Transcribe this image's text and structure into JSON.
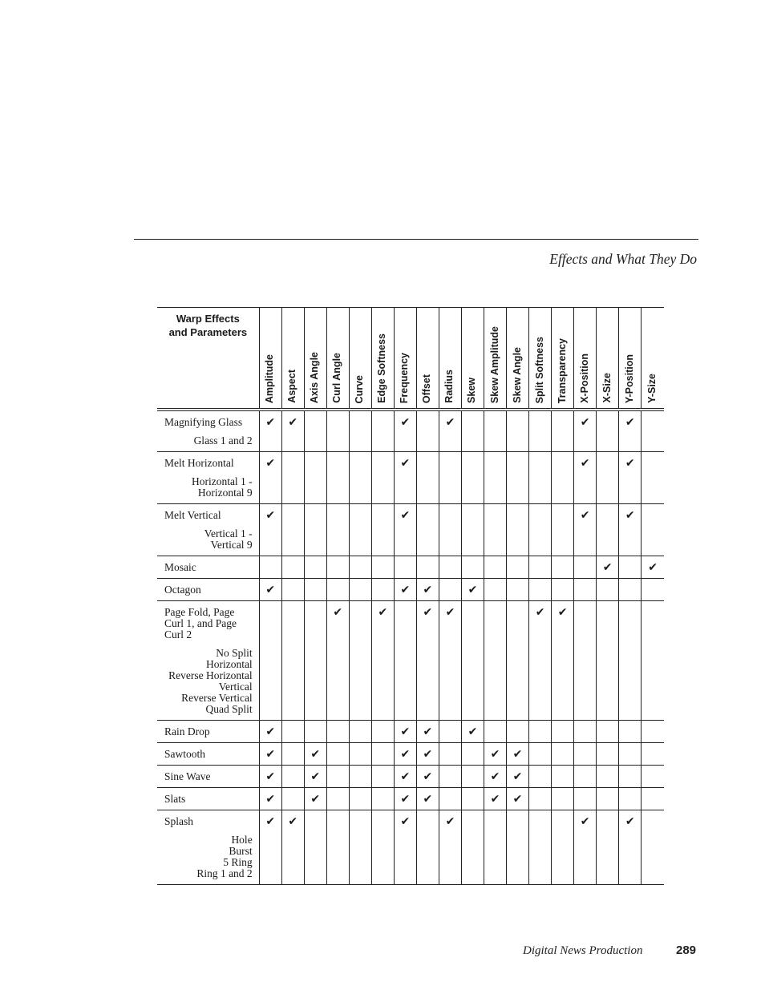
{
  "header": {
    "running_head": "Effects and What They Do"
  },
  "footer": {
    "book_title": "Digital News Production",
    "page_number": "289"
  },
  "table": {
    "title_line1": "Warp Effects",
    "title_line2": "and Parameters",
    "check_glyph": "✔",
    "columns": [
      "Amplitude",
      "Aspect",
      "Axis Angle",
      "Curl Angle",
      "Curve",
      "Edge Softness",
      "Frequency",
      "Offset",
      "Radius",
      "Skew",
      "Skew Amplitude",
      "Skew Angle",
      "Split Softness",
      "Transparency",
      "X-Position",
      "X-Size",
      "Y-Position",
      "Y-Size"
    ],
    "rows": [
      {
        "name": "Magnifying Glass",
        "subs": [
          "Glass 1 and 2"
        ],
        "checks": [
          "Amplitude",
          "Aspect",
          "Frequency",
          "Radius",
          "X-Position",
          "Y-Position"
        ]
      },
      {
        "name": "Melt Horizontal",
        "subs": [
          "Horizontal 1 -",
          "Horizontal 9"
        ],
        "checks": [
          "Amplitude",
          "Frequency",
          "X-Position",
          "Y-Position"
        ]
      },
      {
        "name": "Melt Vertical",
        "subs": [
          "Vertical 1 -",
          "Vertical 9"
        ],
        "checks": [
          "Amplitude",
          "Frequency",
          "X-Position",
          "Y-Position"
        ]
      },
      {
        "name": "Mosaic",
        "subs": [],
        "checks": [
          "X-Size",
          "Y-Size"
        ]
      },
      {
        "name": "Octagon",
        "subs": [],
        "checks": [
          "Amplitude",
          "Frequency",
          "Offset",
          "Skew"
        ]
      },
      {
        "name": "Page Fold, Page Curl 1, and Page Curl 2",
        "name_lines": [
          "Page Fold, Page",
          "Curl 1, and Page",
          "Curl 2"
        ],
        "subs": [
          "No Split",
          "Horizontal",
          "Reverse Horizontal",
          "Vertical",
          "Reverse Vertical",
          "Quad Split"
        ],
        "checks": [
          "Curl Angle",
          "Edge Softness",
          "Offset",
          "Radius",
          "Split Softness",
          "Transparency"
        ]
      },
      {
        "name": "Rain Drop",
        "subs": [],
        "checks": [
          "Amplitude",
          "Frequency",
          "Offset",
          "Skew"
        ]
      },
      {
        "name": "Sawtooth",
        "subs": [],
        "checks": [
          "Amplitude",
          "Axis Angle",
          "Frequency",
          "Offset",
          "Skew Amplitude",
          "Skew Angle"
        ]
      },
      {
        "name": "Sine Wave",
        "subs": [],
        "checks": [
          "Amplitude",
          "Axis Angle",
          "Frequency",
          "Offset",
          "Skew Amplitude",
          "Skew Angle"
        ]
      },
      {
        "name": "Slats",
        "subs": [],
        "checks": [
          "Amplitude",
          "Axis Angle",
          "Frequency",
          "Offset",
          "Skew Amplitude",
          "Skew Angle"
        ]
      },
      {
        "name": "Splash",
        "subs": [
          "Hole",
          "Burst",
          "5 Ring",
          "Ring 1 and 2"
        ],
        "checks": [
          "Amplitude",
          "Aspect",
          "Frequency",
          "Radius",
          "X-Position",
          "Y-Position"
        ]
      }
    ]
  }
}
